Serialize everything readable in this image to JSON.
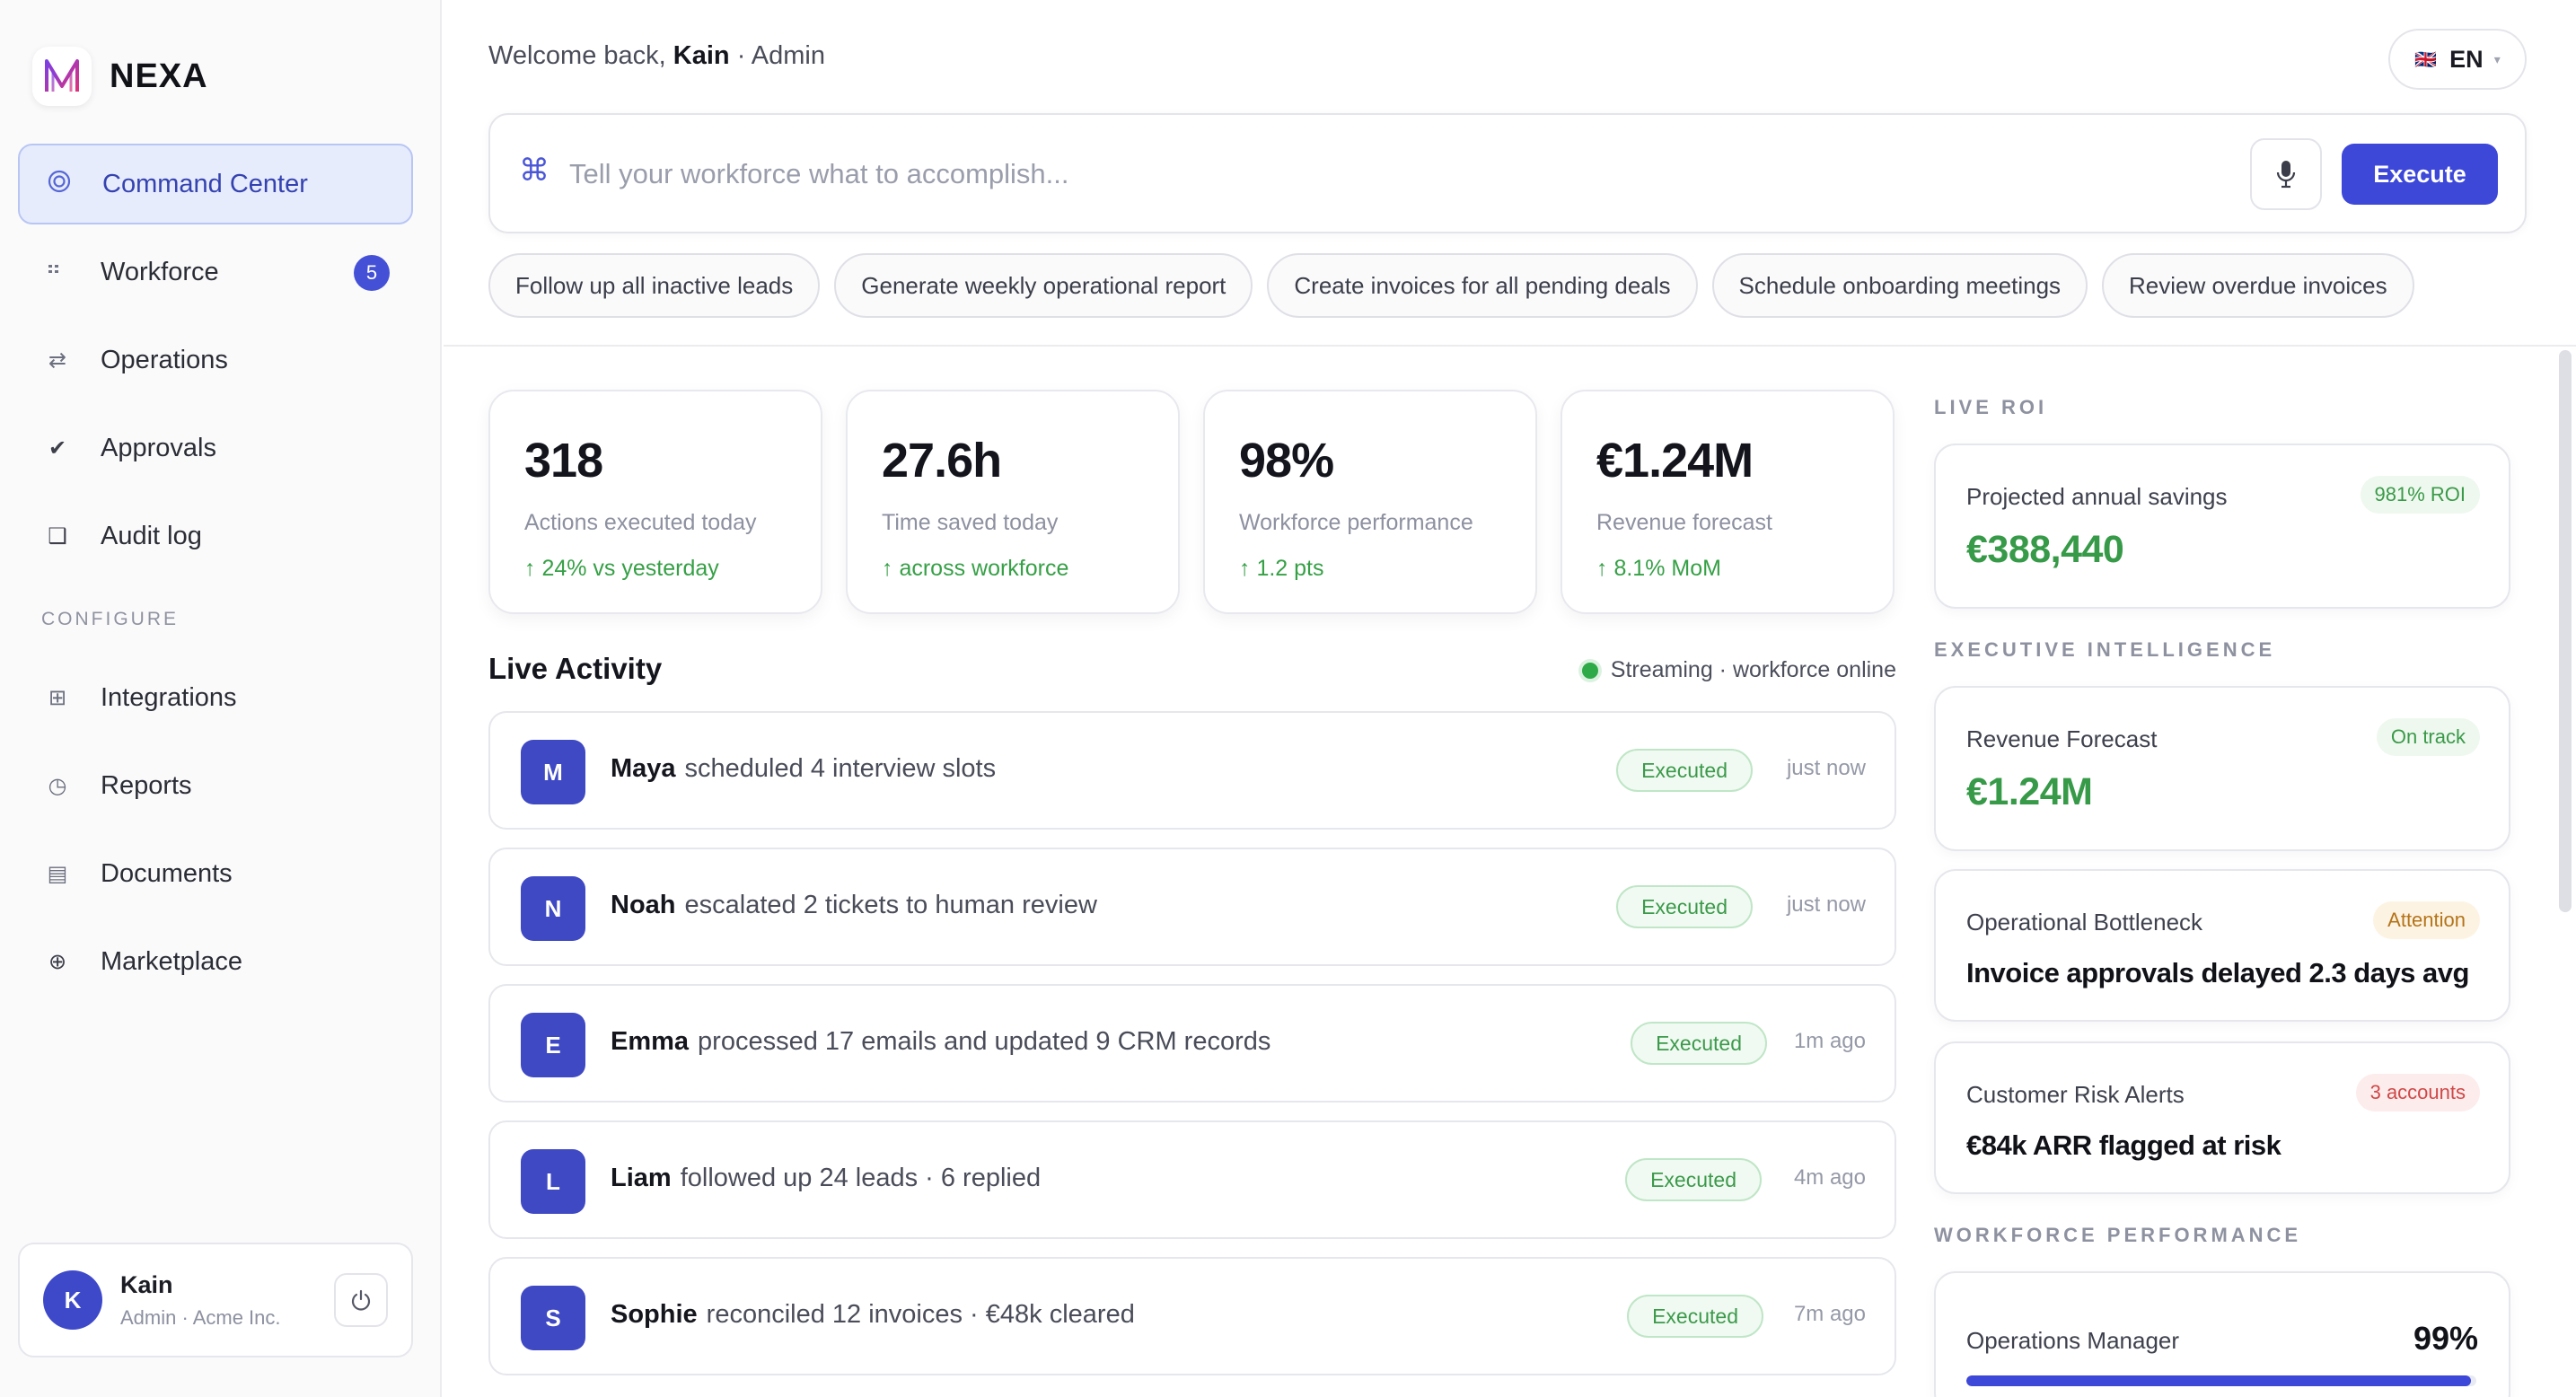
{
  "brand": {
    "name": "NEXA",
    "logo_glyph": "N"
  },
  "sidebar": {
    "items": [
      {
        "label": "Command Center",
        "icon": "target-icon",
        "active": true
      },
      {
        "label": "Workforce",
        "icon": "grid-dots-icon",
        "badge": "5"
      },
      {
        "label": "Operations",
        "icon": "swap-arrows-icon"
      },
      {
        "label": "Approvals",
        "icon": "check-icon"
      },
      {
        "label": "Audit log",
        "icon": "square-icon"
      }
    ],
    "configure_label": "CONFIGURE",
    "configure_items": [
      {
        "label": "Integrations",
        "icon": "plus-square-icon"
      },
      {
        "label": "Reports",
        "icon": "clock-icon"
      },
      {
        "label": "Documents",
        "icon": "document-icon"
      },
      {
        "label": "Marketplace",
        "icon": "plus-circle-icon"
      }
    ]
  },
  "user": {
    "initial": "K",
    "name": "Kain",
    "role": "Admin · Acme Inc."
  },
  "header": {
    "welcome_prefix": "Welcome back,",
    "welcome_name": "Kain",
    "welcome_suffix": "· Admin",
    "lang": "EN",
    "lang_flag": "🇬🇧",
    "lang_caret": "▾"
  },
  "command": {
    "icon": "⌘",
    "placeholder": "Tell your workforce what to accomplish...",
    "value": "",
    "execute_label": "Execute"
  },
  "suggestions": [
    "Follow up all inactive leads",
    "Generate weekly operational report",
    "Create invoices for all pending deals",
    "Schedule onboarding meetings",
    "Review overdue invoices"
  ],
  "stats": [
    {
      "value": "318",
      "label": "Actions executed today",
      "delta": "↑ 24% vs yesterday"
    },
    {
      "value": "27.6h",
      "label": "Time saved today",
      "delta": "↑ across workforce"
    },
    {
      "value": "98%",
      "label": "Workforce performance",
      "delta": "↑ 1.2 pts"
    },
    {
      "value": "€1.24M",
      "label": "Revenue forecast",
      "delta": "↑ 8.1% MoM"
    }
  ],
  "activity": {
    "title": "Live Activity",
    "status": "Streaming · workforce online",
    "rows": [
      {
        "initial": "M",
        "name": "Maya",
        "text": "scheduled 4 interview slots",
        "badge": "Executed",
        "time": "just now"
      },
      {
        "initial": "N",
        "name": "Noah",
        "text": "escalated 2 tickets to human review",
        "badge": "Executed",
        "time": "just now"
      },
      {
        "initial": "E",
        "name": "Emma",
        "text": "processed 17 emails and updated 9 CRM records",
        "badge": "Executed",
        "time": "1m ago"
      },
      {
        "initial": "L",
        "name": "Liam",
        "text": "followed up 24 leads · 6 replied",
        "badge": "Executed",
        "time": "4m ago"
      },
      {
        "initial": "S",
        "name": "Sophie",
        "text": "reconciled 12 invoices · €48k cleared",
        "badge": "Executed",
        "time": "7m ago"
      }
    ]
  },
  "live_roi": {
    "section": "LIVE ROI",
    "label": "Projected annual savings",
    "pill": "981% ROI",
    "value": "€388,440"
  },
  "exec_intel": {
    "section": "EXECUTIVE INTELLIGENCE",
    "cards": [
      {
        "label": "Revenue Forecast",
        "pill": "On track",
        "value": "€1.24M"
      },
      {
        "label": "Operational Bottleneck",
        "pill": "Attention",
        "value": "Invoice approvals delayed 2.3 days avg"
      },
      {
        "label": "Customer Risk Alerts",
        "pill": "3 accounts",
        "value": "€84k ARR flagged at risk"
      }
    ]
  },
  "workforce_perf": {
    "section": "WORKFORCE PERFORMANCE",
    "label": "Operations Manager",
    "value": "99%",
    "progress": 0.99
  },
  "colors": {
    "accent": "#3d47d8",
    "success": "#379a48",
    "warning": "#b4741a",
    "danger": "#d04848"
  }
}
